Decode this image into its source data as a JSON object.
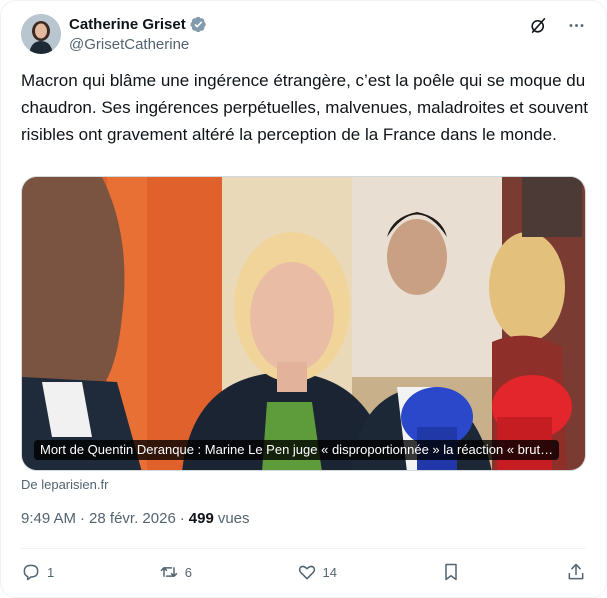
{
  "author": {
    "name": "Catherine Griset",
    "handle": "@GrisetCatherine",
    "verified_icon": "verified-badge-icon"
  },
  "header_icons": [
    "grok-icon",
    "more-options-icon"
  ],
  "tweet": {
    "text": "Macron qui blâme une ingérence étrangère, c’est la poêle qui se moque du chaudron. Ses ingérences perpétuelles, malvenues, maladroites et souvent risibles ont gravement altéré la perception de la France dans le monde."
  },
  "card": {
    "caption": "Mort de Quentin Deranque : Marine Le Pen juge « disproportionnée » la réaction « brut…",
    "source": "De leparisien.fr"
  },
  "meta": {
    "time": "9:49 AM",
    "separator": "·",
    "date": "28 févr. 2026",
    "views_count": "499",
    "views_label": "vues"
  },
  "actions": {
    "replies": "1",
    "reposts": "6",
    "likes": "14"
  },
  "colors": {
    "text": "#0f1419",
    "secondary": "#536471",
    "verified": "#829aab",
    "border": "#cfd9de"
  }
}
